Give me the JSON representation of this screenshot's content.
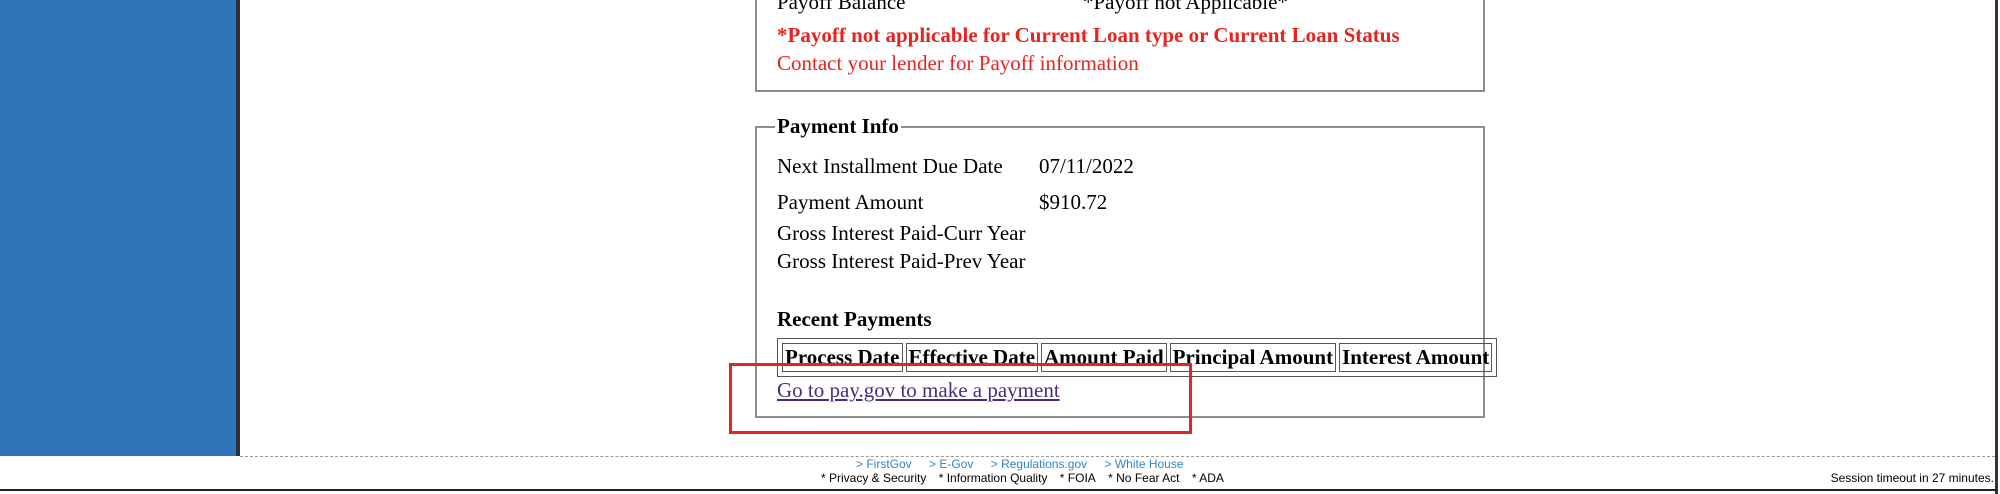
{
  "payoff": {
    "label": "Payoff Balance",
    "value": "*Payoff not Applicable*",
    "warning": "*Payoff not applicable for Current Loan type or Current Loan Status",
    "contact": "Contact your lender for Payoff information"
  },
  "payment_info": {
    "legend": "Payment Info",
    "next_due_label": "Next Installment Due Date",
    "next_due_value": "07/11/2022",
    "amount_label": "Payment Amount",
    "amount_value": "$910.72",
    "gross_curr_label": "Gross Interest Paid-Curr Year",
    "gross_prev_label": "Gross Interest Paid-Prev Year",
    "recent_title": "Recent Payments",
    "columns": [
      "Process Date",
      "Effective Date",
      "Amount Paid",
      "Principal Amount",
      "Interest Amount"
    ],
    "paygov_link": "Go to pay.gov to make a payment"
  },
  "footer": {
    "links": [
      "> FirstGov",
      "> E-Gov",
      "> Regulations.gov",
      "> White House"
    ],
    "policies": [
      "* Privacy & Security",
      "* Information Quality",
      "* FOIA",
      "* No Fear Act",
      "* ADA"
    ],
    "session": "Session timeout in 27 minutes."
  },
  "colors": {
    "sidebar": "#3075b9",
    "warning": "#e8231f",
    "link": "#4a2b80",
    "highlight": "#e0242a"
  }
}
